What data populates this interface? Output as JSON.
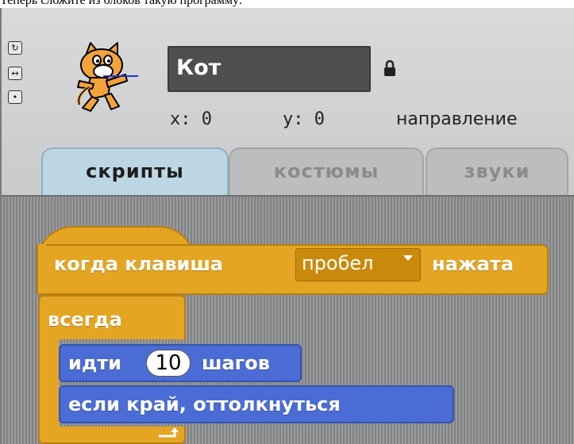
{
  "caption": "Теперь сложите из блоков такую программу:",
  "sprite": {
    "name": "Кот",
    "x_label": "x: 0",
    "y_label": "y: 0",
    "direction_label": "направление"
  },
  "rotation_buttons": [
    "rotate-all-around-icon",
    "left-right-only-icon",
    "no-rotate-icon"
  ],
  "tabs": [
    {
      "label": "скрипты",
      "active": true
    },
    {
      "label": "костюмы",
      "active": false
    },
    {
      "label": "звуки",
      "active": false
    }
  ],
  "script": {
    "hat": {
      "before": "когда клавиша",
      "key": "пробел",
      "after": "нажата"
    },
    "loop": {
      "label": "всегда"
    },
    "move": {
      "before": "идти",
      "steps": "10",
      "after": "шагов"
    },
    "bounce": {
      "label": "если край, оттолкнуться"
    }
  },
  "colors": {
    "control_block": "#e4a523",
    "motion_block": "#4a6cd4",
    "active_tab": "#bdd6e4",
    "script_area": "#8e8f91"
  }
}
